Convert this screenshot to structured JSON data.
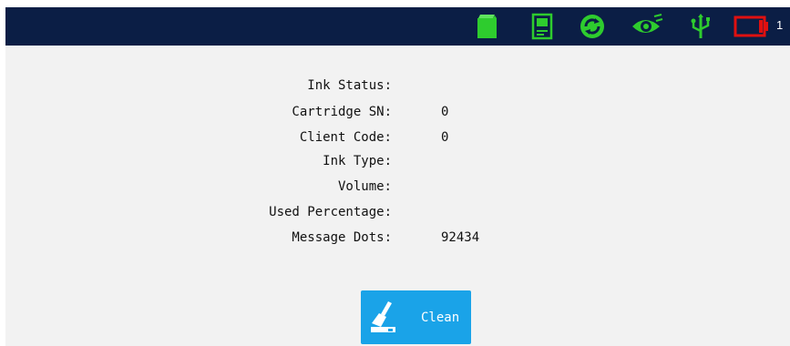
{
  "topbar": {
    "icons": [
      "ink-cartridge-icon",
      "printer-display-icon",
      "refresh-icon",
      "eye-icon",
      "usb-icon",
      "battery-icon"
    ],
    "battery_count": "1",
    "accent_color": "#2ecc2e",
    "battery_color": "#e01010"
  },
  "ink_info": {
    "ink_status_label": "Ink Status:",
    "ink_status_value": "",
    "cartridge_sn_label": "Cartridge SN:",
    "cartridge_sn_value": "0",
    "client_code_label": "Client Code:",
    "client_code_value": "0",
    "ink_type_label": "Ink Type:",
    "ink_type_value": "",
    "volume_label": "Volume:",
    "volume_value": "",
    "used_percentage_label": "Used Percentage:",
    "used_percentage_value": "",
    "message_dots_label": "Message Dots:",
    "message_dots_value": "92434"
  },
  "actions": {
    "clean_label": "Clean",
    "clean_color": "#1aa3e8"
  }
}
